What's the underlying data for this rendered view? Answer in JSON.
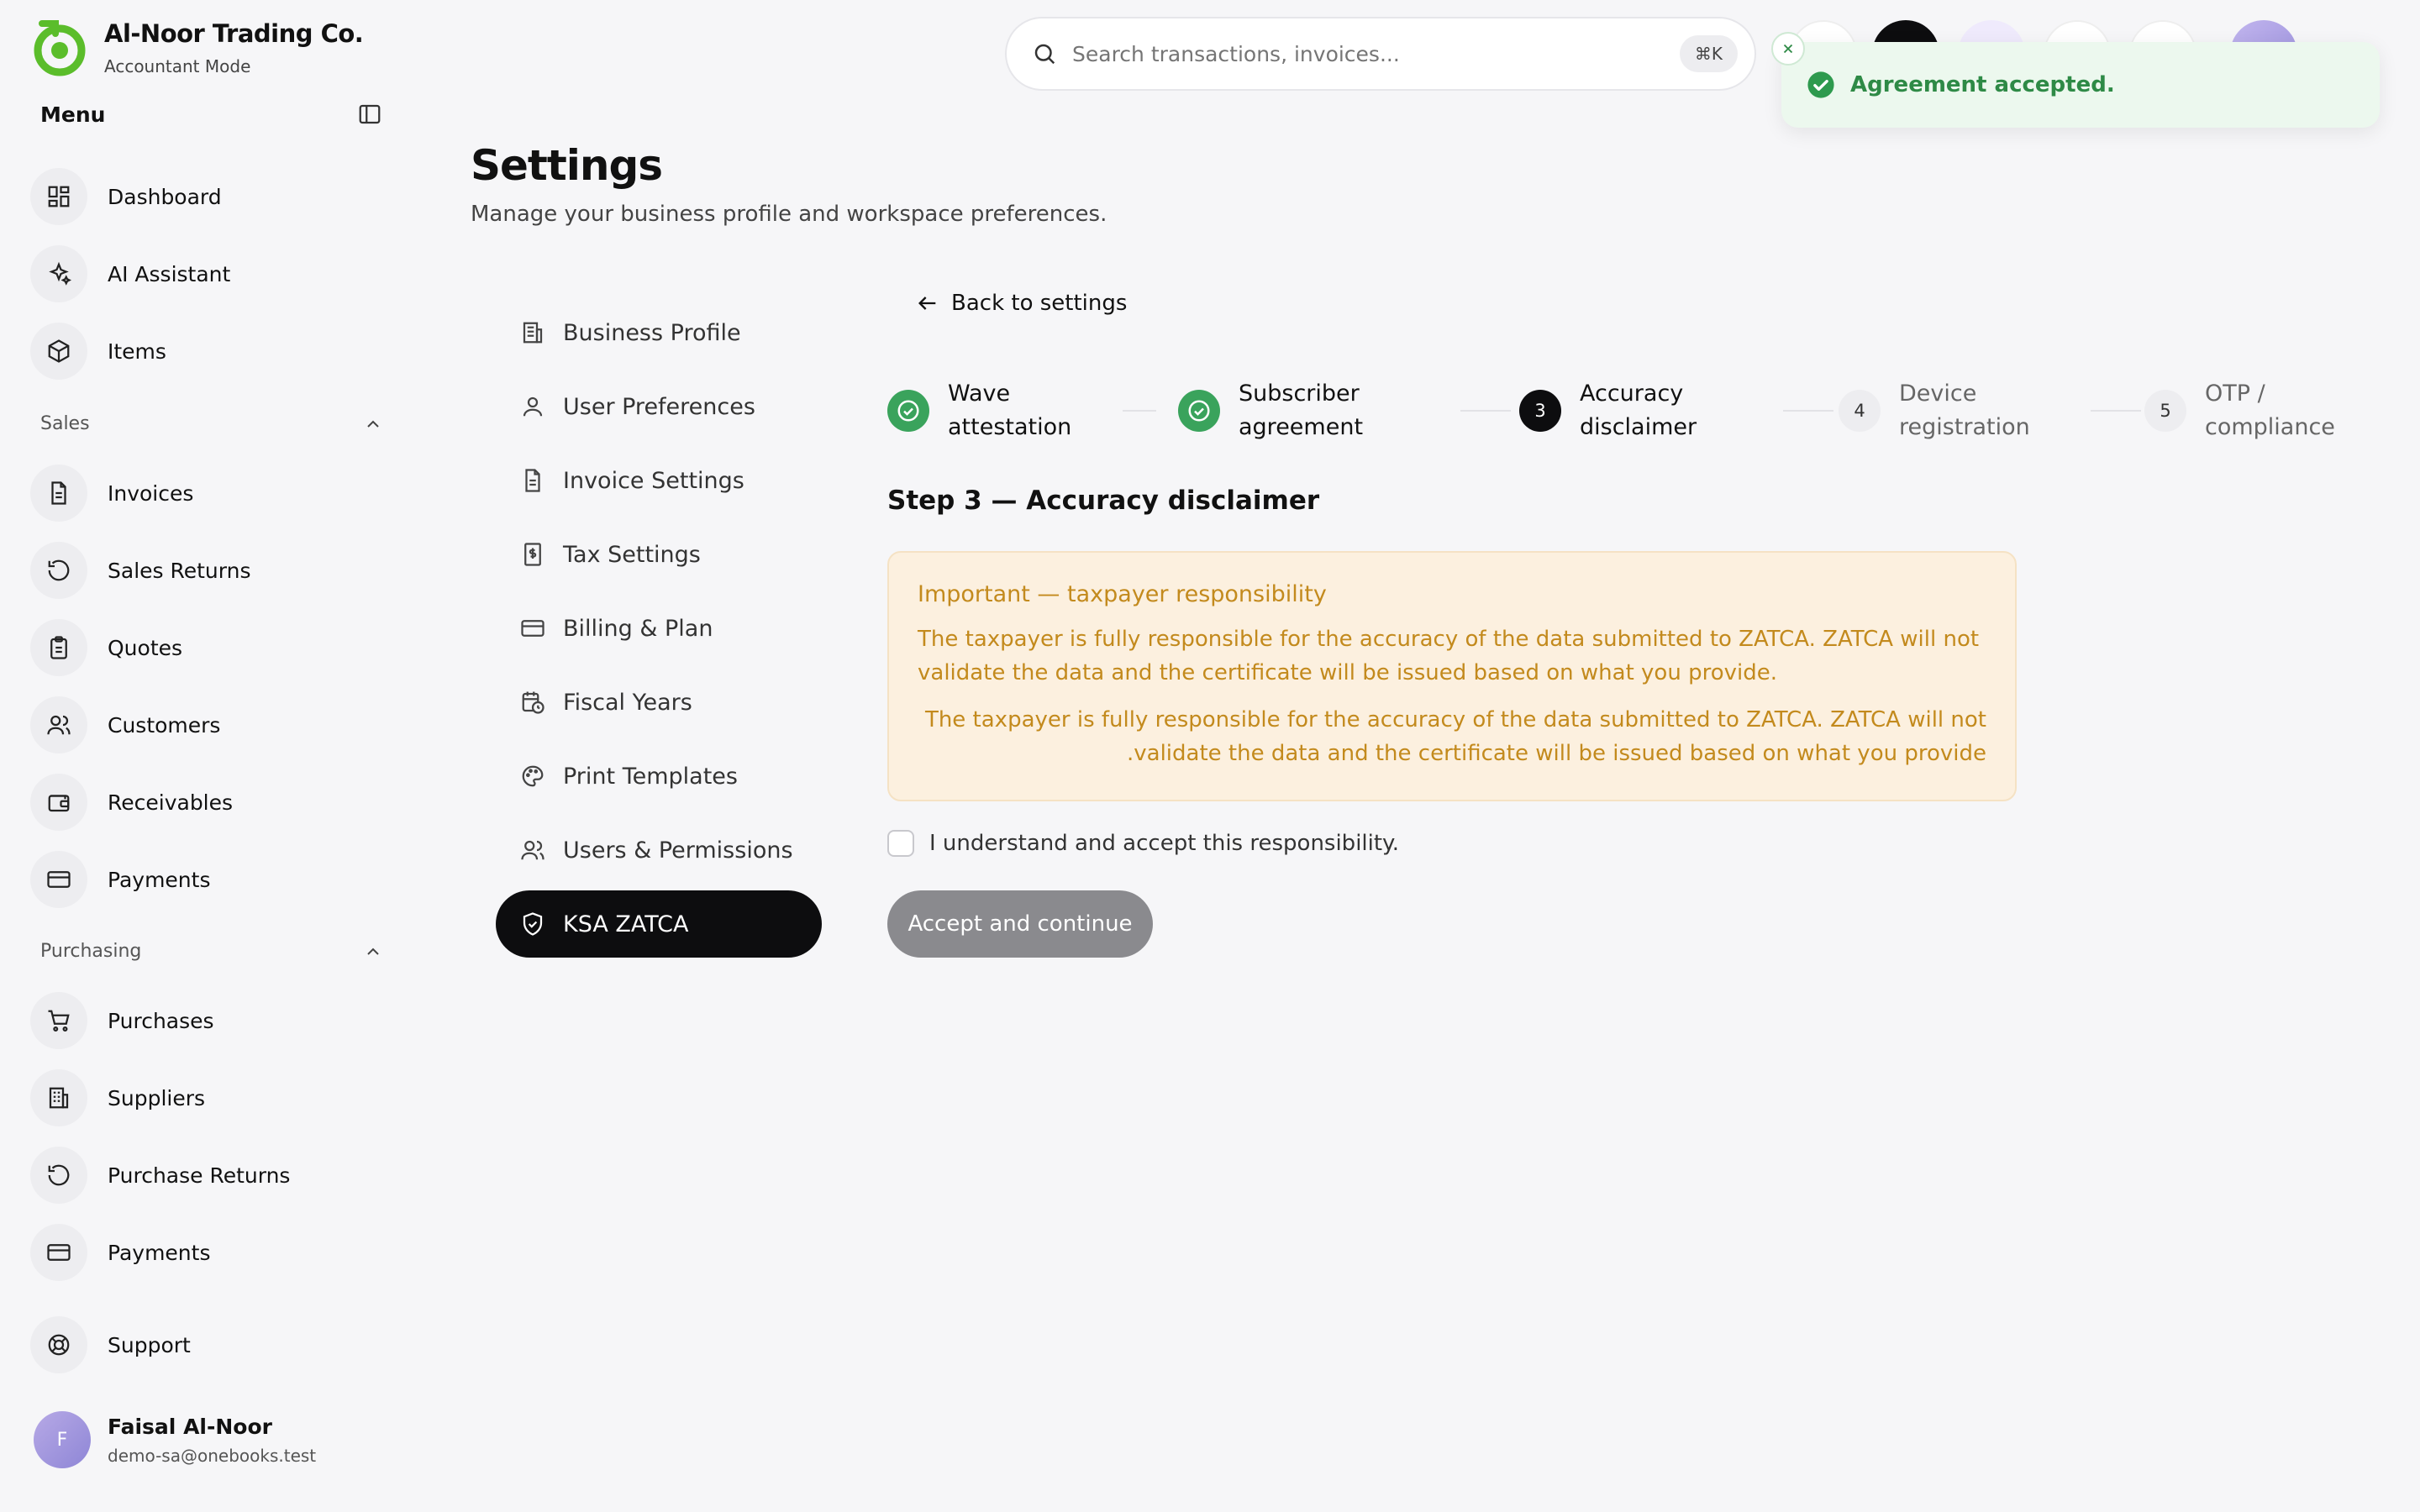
{
  "brand": {
    "name": "Al-Noor Trading Co.",
    "mode": "Accountant Mode"
  },
  "sidebar": {
    "menu_title": "Menu",
    "top_items": [
      {
        "label": "Dashboard",
        "icon": "dashboard-icon"
      },
      {
        "label": "AI Assistant",
        "icon": "sparkles-icon"
      },
      {
        "label": "Items",
        "icon": "box-icon"
      }
    ],
    "sales": {
      "title": "Sales",
      "items": [
        {
          "label": "Invoices",
          "icon": "file-text-icon"
        },
        {
          "label": "Sales Returns",
          "icon": "rotate-ccw-icon"
        },
        {
          "label": "Quotes",
          "icon": "clipboard-icon"
        },
        {
          "label": "Customers",
          "icon": "users-icon"
        },
        {
          "label": "Receivables",
          "icon": "wallet-icon"
        },
        {
          "label": "Payments",
          "icon": "credit-card-icon"
        }
      ]
    },
    "purchasing": {
      "title": "Purchasing",
      "items": [
        {
          "label": "Purchases",
          "icon": "cart-icon"
        },
        {
          "label": "Suppliers",
          "icon": "building-icon"
        },
        {
          "label": "Purchase Returns",
          "icon": "rotate-ccw-icon"
        },
        {
          "label": "Payments",
          "icon": "credit-card-icon"
        }
      ]
    },
    "support": {
      "label": "Support",
      "icon": "lifebuoy-icon"
    },
    "user": {
      "initial": "F",
      "name": "Faisal Al-Noor",
      "email": "demo-sa@onebooks.test"
    }
  },
  "search": {
    "placeholder": "Search transactions, invoices...",
    "shortcut": "⌘K"
  },
  "toast": {
    "message": "Agreement accepted."
  },
  "page": {
    "title": "Settings",
    "subtitle": "Manage your business profile and workspace preferences."
  },
  "settings_nav": [
    {
      "label": "Business Profile",
      "icon": "building-icon"
    },
    {
      "label": "User Preferences",
      "icon": "user-icon"
    },
    {
      "label": "Invoice Settings",
      "icon": "file-text-icon"
    },
    {
      "label": "Tax Settings",
      "icon": "receipt-dollar-icon"
    },
    {
      "label": "Billing & Plan",
      "icon": "credit-card-icon"
    },
    {
      "label": "Fiscal Years",
      "icon": "calendar-clock-icon"
    },
    {
      "label": "Print Templates",
      "icon": "palette-icon"
    },
    {
      "label": "Users & Permissions",
      "icon": "users-icon"
    },
    {
      "label": "KSA ZATCA",
      "icon": "shield-check-icon",
      "active": true
    }
  ],
  "back_label": "Back to settings",
  "steps": [
    {
      "number": "",
      "line1": "Wave",
      "line2": "attestation",
      "state": "done"
    },
    {
      "number": "",
      "line1": "Subscriber",
      "line2": "agreement",
      "state": "done"
    },
    {
      "number": "3",
      "line1": "Accuracy",
      "line2": "disclaimer",
      "state": "current"
    },
    {
      "number": "4",
      "line1": "Device",
      "line2": "registration",
      "state": "todo"
    },
    {
      "number": "5",
      "line1": "OTP /",
      "line2": "compliance",
      "state": "todo"
    }
  ],
  "step_heading": "Step 3 — Accuracy disclaimer",
  "warning": {
    "title": "Important — taxpayer responsibility",
    "text_en": "The taxpayer is fully responsible for the accuracy of the data submitted to ZATCA. ZATCA will not validate the data and the certificate will be issued based on what you provide.",
    "text_rtl_line1": "The taxpayer is fully responsible for the accuracy of the data submitted to ZATCA. ZATCA will not",
    "text_rtl_line2": ".validate the data and the certificate will be issued based on what you provide"
  },
  "checkbox_label": "I understand and accept this responsibility.",
  "accept_button": "Accept and continue",
  "colors": {
    "brand_green": "#5bbd2b",
    "success": "#3aa35c",
    "warning_text": "#c38a1d",
    "warning_bg": "#fcf0df",
    "active_nav": "#0d0d0f"
  }
}
